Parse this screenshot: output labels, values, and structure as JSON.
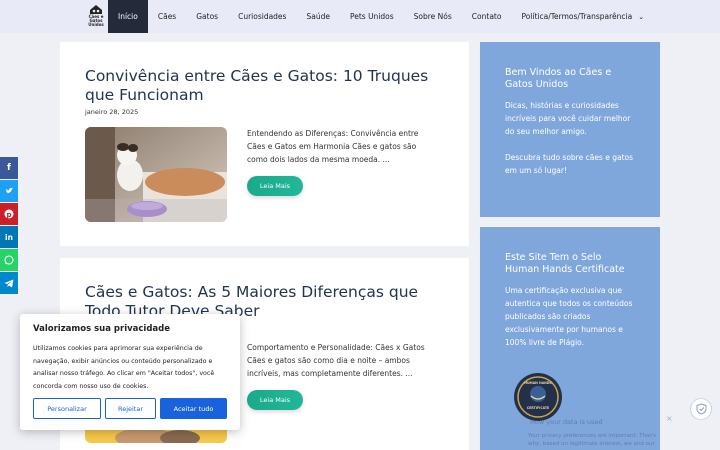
{
  "logo": {
    "text_lines": [
      "Cães e",
      "Gatos",
      "Unidos"
    ]
  },
  "nav": {
    "items": [
      {
        "label": "Início",
        "active": true
      },
      {
        "label": "Cães"
      },
      {
        "label": "Gatos"
      },
      {
        "label": "Curiosidades"
      },
      {
        "label": "Saúde"
      },
      {
        "label": "Pets Unidos"
      },
      {
        "label": "Sobre Nós"
      },
      {
        "label": "Contato"
      },
      {
        "label": "Política/Termos/Transparência",
        "dropdown": true
      }
    ]
  },
  "posts": [
    {
      "title": "Convivência entre Cães e Gatos: 10 Truques que Funcionam",
      "date": "janeiro 28, 2025",
      "excerpt": "Entendendo as Diferenças: Convivência entre Cães e Gatos em Harmonia Cães e gatos são como dois lados da mesma moeda. ...",
      "read_more": "Leia Mais"
    },
    {
      "title": "Cães e Gatos: As 5 Maiores Diferenças que Todo Tutor Deve Saber",
      "excerpt": "Comportamento e Personalidade: Cães x Gatos Cães e gatos são como dia e noite – ambos incríveis, mas completamente diferentes. ...",
      "read_more": "Leia Mais"
    }
  ],
  "sidebar": {
    "widget1": {
      "title": "Bem Vindos ao Cães e Gatos Unidos",
      "text1": "Dicas, histórias e curiosidades incríveis para você cuidar melhor do seu melhor amigo.",
      "text2": "Descubra tudo sobre cães e gatos em um só lugar!"
    },
    "widget2": {
      "title": "Este Site Tem o Selo Human Hands Certificate",
      "text": "Uma certificação exclusiva que autentica que todos os conteúdos publicados são criados exclusivamente por humanos e 100% livre de Plágio.",
      "badge_lines": [
        "HUMAN HANDS",
        "CERTIFICATE"
      ]
    }
  },
  "social": [
    {
      "icon": "facebook-icon",
      "color": "#3b5998"
    },
    {
      "icon": "twitter-icon",
      "color": "#1da1f2"
    },
    {
      "icon": "pinterest-icon",
      "color": "#cb2027"
    },
    {
      "icon": "linkedin-icon",
      "color": "#0077b5"
    },
    {
      "icon": "whatsapp-icon",
      "color": "#25d366"
    },
    {
      "icon": "telegram-icon",
      "color": "#0088cc"
    }
  ],
  "cookie": {
    "title": "Valorizamos sua privacidade",
    "text": "Utilizamos cookies para aprimorar sua experiência de navegação, exibir anúncios ou conteúdo personalizado e analisar nosso tráfego. Ao clicar em \"Aceitar todos\", você concorda com nosso uso de cookies.",
    "customize": "Personalizar",
    "reject": "Rejeitar",
    "accept": "Aceitar tudo"
  },
  "privacy_notice": {
    "line1": "How your data is used",
    "line2": "Your privacy preferences are important. That's why, based on legitimate interest, we and our"
  }
}
